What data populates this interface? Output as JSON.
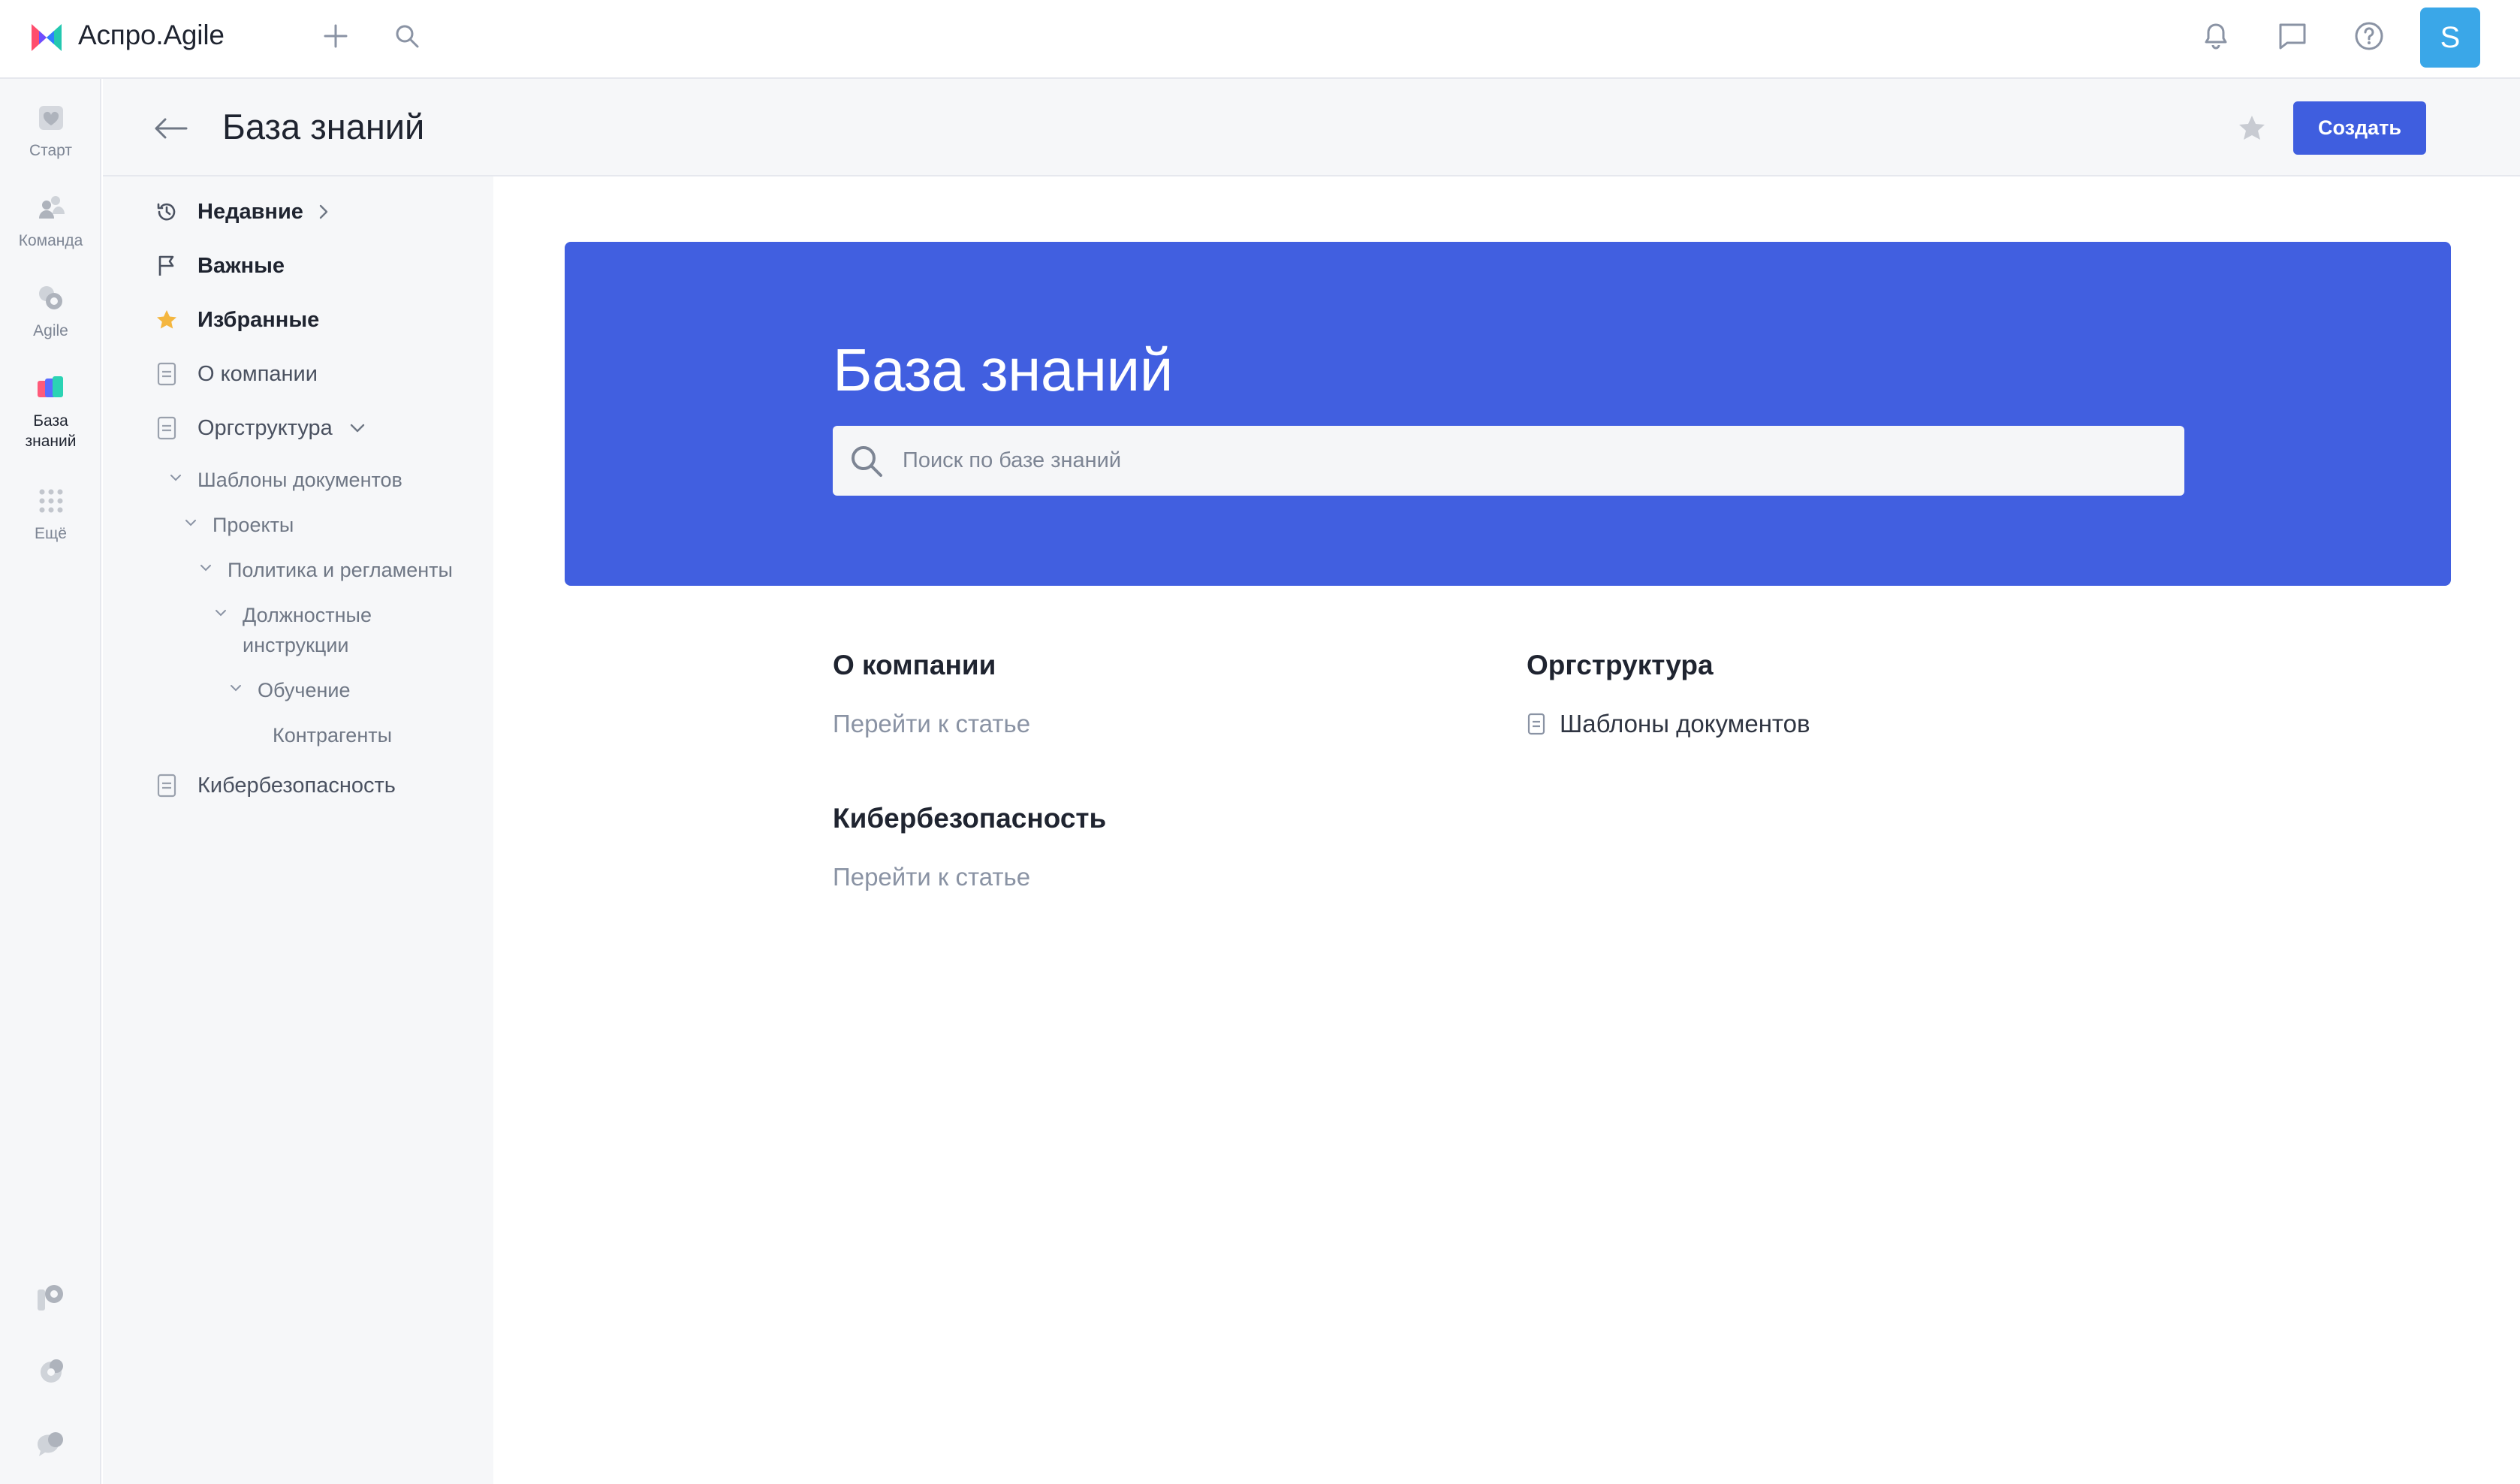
{
  "app": {
    "title": "Аспро.Agile",
    "avatar_letter": "S"
  },
  "rail": {
    "items": [
      {
        "label": "Старт",
        "icon": "heart-icon"
      },
      {
        "label": "Команда",
        "icon": "team-icon"
      },
      {
        "label": "Agile",
        "icon": "agile-icon"
      },
      {
        "label": "База\nзнаний",
        "icon": "knowledge-base-icon",
        "active": true
      },
      {
        "label": "Ещё",
        "icon": "grid-dots-icon"
      }
    ]
  },
  "header": {
    "title": "База знаний",
    "create_label": "Создать"
  },
  "sidebar": {
    "recent": "Недавние",
    "important": "Важные",
    "favorites": "Избранные",
    "about": "О компании",
    "org": "Оргструктура",
    "children": [
      "Шаблоны документов",
      "Проекты",
      "Политика и регламенты",
      "Должностные инструкции",
      "Обучение",
      "Контрагенты"
    ],
    "cyber": "Кибербезопасность"
  },
  "hero": {
    "title": "База знаний",
    "search_placeholder": "Поиск по базе знаний"
  },
  "cards": [
    {
      "title": "О компании",
      "link": "Перейти к статье"
    },
    {
      "title": "Оргструктура",
      "doc": "Шаблоны документов"
    },
    {
      "title": "Кибербезопасность",
      "link": "Перейти к статье"
    }
  ],
  "colors": {
    "accent": "#3f5edf",
    "hero": "#415fe0",
    "avatar": "#3aa7e8",
    "star": "#f4b63f"
  }
}
